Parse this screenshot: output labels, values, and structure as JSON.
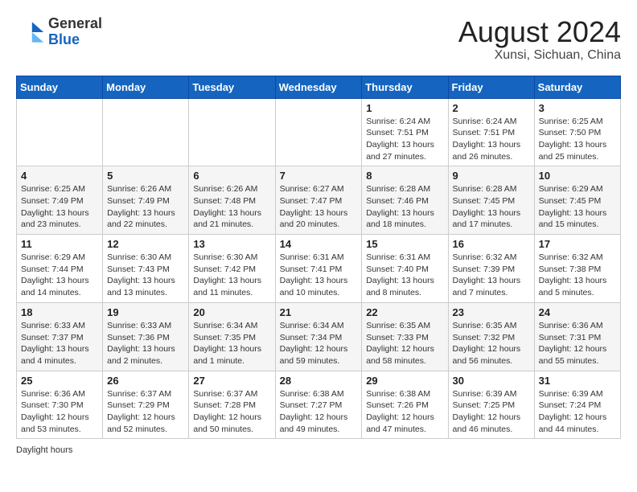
{
  "header": {
    "logo_general": "General",
    "logo_blue": "Blue",
    "month_year": "August 2024",
    "location": "Xunsi, Sichuan, China"
  },
  "days_of_week": [
    "Sunday",
    "Monday",
    "Tuesday",
    "Wednesday",
    "Thursday",
    "Friday",
    "Saturday"
  ],
  "weeks": [
    [
      {
        "day": "",
        "info": ""
      },
      {
        "day": "",
        "info": ""
      },
      {
        "day": "",
        "info": ""
      },
      {
        "day": "",
        "info": ""
      },
      {
        "day": "1",
        "info": "Sunrise: 6:24 AM\nSunset: 7:51 PM\nDaylight: 13 hours and 27 minutes."
      },
      {
        "day": "2",
        "info": "Sunrise: 6:24 AM\nSunset: 7:51 PM\nDaylight: 13 hours and 26 minutes."
      },
      {
        "day": "3",
        "info": "Sunrise: 6:25 AM\nSunset: 7:50 PM\nDaylight: 13 hours and 25 minutes."
      }
    ],
    [
      {
        "day": "4",
        "info": "Sunrise: 6:25 AM\nSunset: 7:49 PM\nDaylight: 13 hours and 23 minutes."
      },
      {
        "day": "5",
        "info": "Sunrise: 6:26 AM\nSunset: 7:49 PM\nDaylight: 13 hours and 22 minutes."
      },
      {
        "day": "6",
        "info": "Sunrise: 6:26 AM\nSunset: 7:48 PM\nDaylight: 13 hours and 21 minutes."
      },
      {
        "day": "7",
        "info": "Sunrise: 6:27 AM\nSunset: 7:47 PM\nDaylight: 13 hours and 20 minutes."
      },
      {
        "day": "8",
        "info": "Sunrise: 6:28 AM\nSunset: 7:46 PM\nDaylight: 13 hours and 18 minutes."
      },
      {
        "day": "9",
        "info": "Sunrise: 6:28 AM\nSunset: 7:45 PM\nDaylight: 13 hours and 17 minutes."
      },
      {
        "day": "10",
        "info": "Sunrise: 6:29 AM\nSunset: 7:45 PM\nDaylight: 13 hours and 15 minutes."
      }
    ],
    [
      {
        "day": "11",
        "info": "Sunrise: 6:29 AM\nSunset: 7:44 PM\nDaylight: 13 hours and 14 minutes."
      },
      {
        "day": "12",
        "info": "Sunrise: 6:30 AM\nSunset: 7:43 PM\nDaylight: 13 hours and 13 minutes."
      },
      {
        "day": "13",
        "info": "Sunrise: 6:30 AM\nSunset: 7:42 PM\nDaylight: 13 hours and 11 minutes."
      },
      {
        "day": "14",
        "info": "Sunrise: 6:31 AM\nSunset: 7:41 PM\nDaylight: 13 hours and 10 minutes."
      },
      {
        "day": "15",
        "info": "Sunrise: 6:31 AM\nSunset: 7:40 PM\nDaylight: 13 hours and 8 minutes."
      },
      {
        "day": "16",
        "info": "Sunrise: 6:32 AM\nSunset: 7:39 PM\nDaylight: 13 hours and 7 minutes."
      },
      {
        "day": "17",
        "info": "Sunrise: 6:32 AM\nSunset: 7:38 PM\nDaylight: 13 hours and 5 minutes."
      }
    ],
    [
      {
        "day": "18",
        "info": "Sunrise: 6:33 AM\nSunset: 7:37 PM\nDaylight: 13 hours and 4 minutes."
      },
      {
        "day": "19",
        "info": "Sunrise: 6:33 AM\nSunset: 7:36 PM\nDaylight: 13 hours and 2 minutes."
      },
      {
        "day": "20",
        "info": "Sunrise: 6:34 AM\nSunset: 7:35 PM\nDaylight: 13 hours and 1 minute."
      },
      {
        "day": "21",
        "info": "Sunrise: 6:34 AM\nSunset: 7:34 PM\nDaylight: 12 hours and 59 minutes."
      },
      {
        "day": "22",
        "info": "Sunrise: 6:35 AM\nSunset: 7:33 PM\nDaylight: 12 hours and 58 minutes."
      },
      {
        "day": "23",
        "info": "Sunrise: 6:35 AM\nSunset: 7:32 PM\nDaylight: 12 hours and 56 minutes."
      },
      {
        "day": "24",
        "info": "Sunrise: 6:36 AM\nSunset: 7:31 PM\nDaylight: 12 hours and 55 minutes."
      }
    ],
    [
      {
        "day": "25",
        "info": "Sunrise: 6:36 AM\nSunset: 7:30 PM\nDaylight: 12 hours and 53 minutes."
      },
      {
        "day": "26",
        "info": "Sunrise: 6:37 AM\nSunset: 7:29 PM\nDaylight: 12 hours and 52 minutes."
      },
      {
        "day": "27",
        "info": "Sunrise: 6:37 AM\nSunset: 7:28 PM\nDaylight: 12 hours and 50 minutes."
      },
      {
        "day": "28",
        "info": "Sunrise: 6:38 AM\nSunset: 7:27 PM\nDaylight: 12 hours and 49 minutes."
      },
      {
        "day": "29",
        "info": "Sunrise: 6:38 AM\nSunset: 7:26 PM\nDaylight: 12 hours and 47 minutes."
      },
      {
        "day": "30",
        "info": "Sunrise: 6:39 AM\nSunset: 7:25 PM\nDaylight: 12 hours and 46 minutes."
      },
      {
        "day": "31",
        "info": "Sunrise: 6:39 AM\nSunset: 7:24 PM\nDaylight: 12 hours and 44 minutes."
      }
    ]
  ],
  "footer": {
    "daylight_label": "Daylight hours"
  }
}
